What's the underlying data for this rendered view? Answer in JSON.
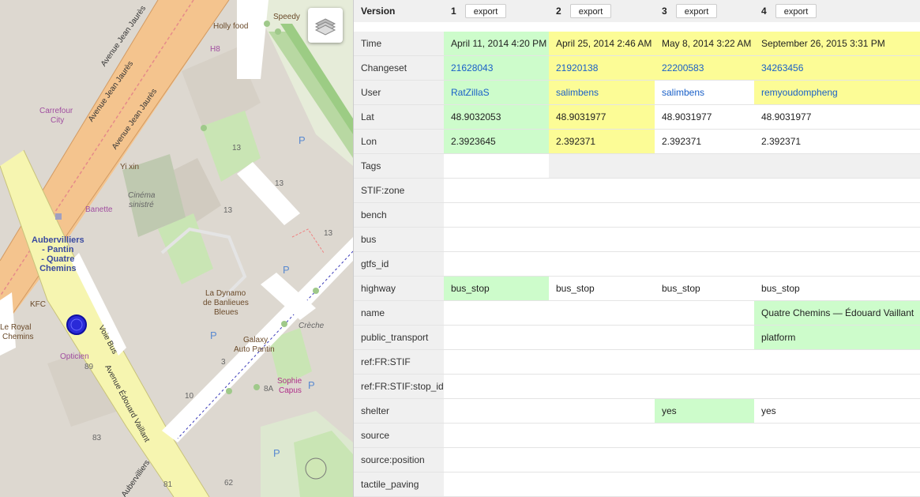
{
  "map": {
    "roads": [
      "Avenue Jean Jaurès",
      "Avenue Jean Jaurès",
      "Avenue Jean Jaurès",
      "Voie Bus",
      "Avenue Édouard Vaillant",
      "Aubervilliers"
    ],
    "places": [
      {
        "text": "Speedy",
        "style": "brown"
      },
      {
        "text": "Holly food",
        "style": "brown"
      },
      {
        "text": "H8",
        "style": "purple"
      },
      {
        "text": "Carrefour",
        "style": "purple"
      },
      {
        "text": "City",
        "style": "purple"
      },
      {
        "text": "Yi xin",
        "style": "brown"
      },
      {
        "text": "Cinéma",
        "style": "italic"
      },
      {
        "text": "sinistré",
        "style": "italic"
      },
      {
        "text": "Banette",
        "style": "purple"
      },
      {
        "text": "13",
        "style": "gray"
      },
      {
        "text": "13",
        "style": "gray"
      },
      {
        "text": "13",
        "style": "gray"
      },
      {
        "text": "13",
        "style": "gray"
      },
      {
        "text": "KFC",
        "style": "brown"
      },
      {
        "text": "Le Royal",
        "style": "brown"
      },
      {
        "text": "Chemins",
        "style": "brown"
      },
      {
        "text": "Opticien",
        "style": "purple"
      },
      {
        "text": "89",
        "style": "gray"
      },
      {
        "text": "La Dynamo",
        "style": "brown"
      },
      {
        "text": "de Banlieues",
        "style": "brown"
      },
      {
        "text": "Bleues",
        "style": "brown"
      },
      {
        "text": "Galaxy",
        "style": "brown"
      },
      {
        "text": "Auto Pantin",
        "style": "brown"
      },
      {
        "text": "Crèche",
        "style": "italic"
      },
      {
        "text": "Sophie",
        "style": "pink"
      },
      {
        "text": "Capus",
        "style": "pink"
      },
      {
        "text": "8A",
        "style": "gray"
      },
      {
        "text": "3",
        "style": "gray"
      },
      {
        "text": "10",
        "style": "gray"
      },
      {
        "text": "83",
        "style": "gray"
      },
      {
        "text": "81",
        "style": "gray"
      },
      {
        "text": "62",
        "style": "gray"
      },
      {
        "text": "P",
        "style": "blue"
      },
      {
        "text": "P",
        "style": "blue"
      },
      {
        "text": "P",
        "style": "blue"
      },
      {
        "text": "P",
        "style": "blue"
      },
      {
        "text": "P",
        "style": "blue"
      }
    ],
    "stop_label": [
      "Aubervilliers",
      "- Pantin",
      "- Quatre",
      "Chemins"
    ],
    "layers_icon": "layers-icon"
  },
  "history": {
    "header": {
      "label": "Version",
      "versions": [
        {
          "num": "1",
          "export_label": "export"
        },
        {
          "num": "2",
          "export_label": "export"
        },
        {
          "num": "3",
          "export_label": "export"
        },
        {
          "num": "4",
          "export_label": "export"
        }
      ]
    },
    "rows": [
      {
        "key": "Time",
        "cells": [
          "April 11, 2014 4:20 PM",
          "April 25, 2014 2:46 AM",
          "May 8, 2014 3:22 AM",
          "September 26, 2015 3:31 PM"
        ],
        "colors": [
          "green",
          "yellow",
          "yellow",
          "yellow"
        ],
        "links": false
      },
      {
        "key": "Changeset",
        "cells": [
          "21628043",
          "21920138",
          "22200583",
          "34263456"
        ],
        "colors": [
          "green",
          "yellow",
          "yellow",
          "yellow"
        ],
        "links": true
      },
      {
        "key": "User",
        "cells": [
          "RatZillaS",
          "salimbens",
          "salimbens",
          "remyoudompheng"
        ],
        "colors": [
          "green",
          "yellow",
          "",
          "yellow"
        ],
        "links": true
      },
      {
        "key": "Lat",
        "cells": [
          "48.9032053",
          "48.9031977",
          "48.9031977",
          "48.9031977"
        ],
        "colors": [
          "green",
          "yellow",
          "",
          ""
        ],
        "links": false
      },
      {
        "key": "Lon",
        "cells": [
          "2.3923645",
          "2.392371",
          "2.392371",
          "2.392371"
        ],
        "colors": [
          "green",
          "yellow",
          "",
          ""
        ],
        "links": false
      },
      {
        "key": "Tags",
        "cells": [
          "",
          "",
          "",
          ""
        ],
        "colors": [
          "",
          "",
          "",
          ""
        ],
        "links": false,
        "section": true
      },
      {
        "key": "STIF:zone",
        "cells": [
          "",
          "",
          "",
          ""
        ],
        "colors": [
          "",
          "",
          "",
          ""
        ],
        "links": false
      },
      {
        "key": "bench",
        "cells": [
          "",
          "",
          "",
          ""
        ],
        "colors": [
          "",
          "",
          "",
          ""
        ],
        "links": false
      },
      {
        "key": "bus",
        "cells": [
          "",
          "",
          "",
          ""
        ],
        "colors": [
          "",
          "",
          "",
          ""
        ],
        "links": false
      },
      {
        "key": "gtfs_id",
        "cells": [
          "",
          "",
          "",
          ""
        ],
        "colors": [
          "",
          "",
          "",
          ""
        ],
        "links": false
      },
      {
        "key": "highway",
        "cells": [
          "bus_stop",
          "bus_stop",
          "bus_stop",
          "bus_stop"
        ],
        "colors": [
          "green",
          "",
          "",
          ""
        ],
        "links": false
      },
      {
        "key": "name",
        "cells": [
          "",
          "",
          "",
          "Quatre Chemins — Édouard Vaillant"
        ],
        "colors": [
          "",
          "",
          "",
          "green"
        ],
        "links": false
      },
      {
        "key": "public_transport",
        "cells": [
          "",
          "",
          "",
          "platform"
        ],
        "colors": [
          "",
          "",
          "",
          "green"
        ],
        "links": false
      },
      {
        "key": "ref:FR:STIF",
        "cells": [
          "",
          "",
          "",
          ""
        ],
        "colors": [
          "",
          "",
          "",
          ""
        ],
        "links": false
      },
      {
        "key": "ref:FR:STIF:stop_id",
        "cells": [
          "",
          "",
          "",
          ""
        ],
        "colors": [
          "",
          "",
          "",
          ""
        ],
        "links": false
      },
      {
        "key": "shelter",
        "cells": [
          "",
          "",
          "yes",
          "yes"
        ],
        "colors": [
          "",
          "",
          "green",
          ""
        ],
        "links": false
      },
      {
        "key": "source",
        "cells": [
          "",
          "",
          "",
          ""
        ],
        "colors": [
          "",
          "",
          "",
          ""
        ],
        "links": false
      },
      {
        "key": "source:position",
        "cells": [
          "",
          "",
          "",
          ""
        ],
        "colors": [
          "",
          "",
          "",
          ""
        ],
        "links": false
      },
      {
        "key": "tactile_paving",
        "cells": [
          "",
          "",
          "",
          ""
        ],
        "colors": [
          "",
          "",
          "",
          ""
        ],
        "links": false
      }
    ]
  }
}
